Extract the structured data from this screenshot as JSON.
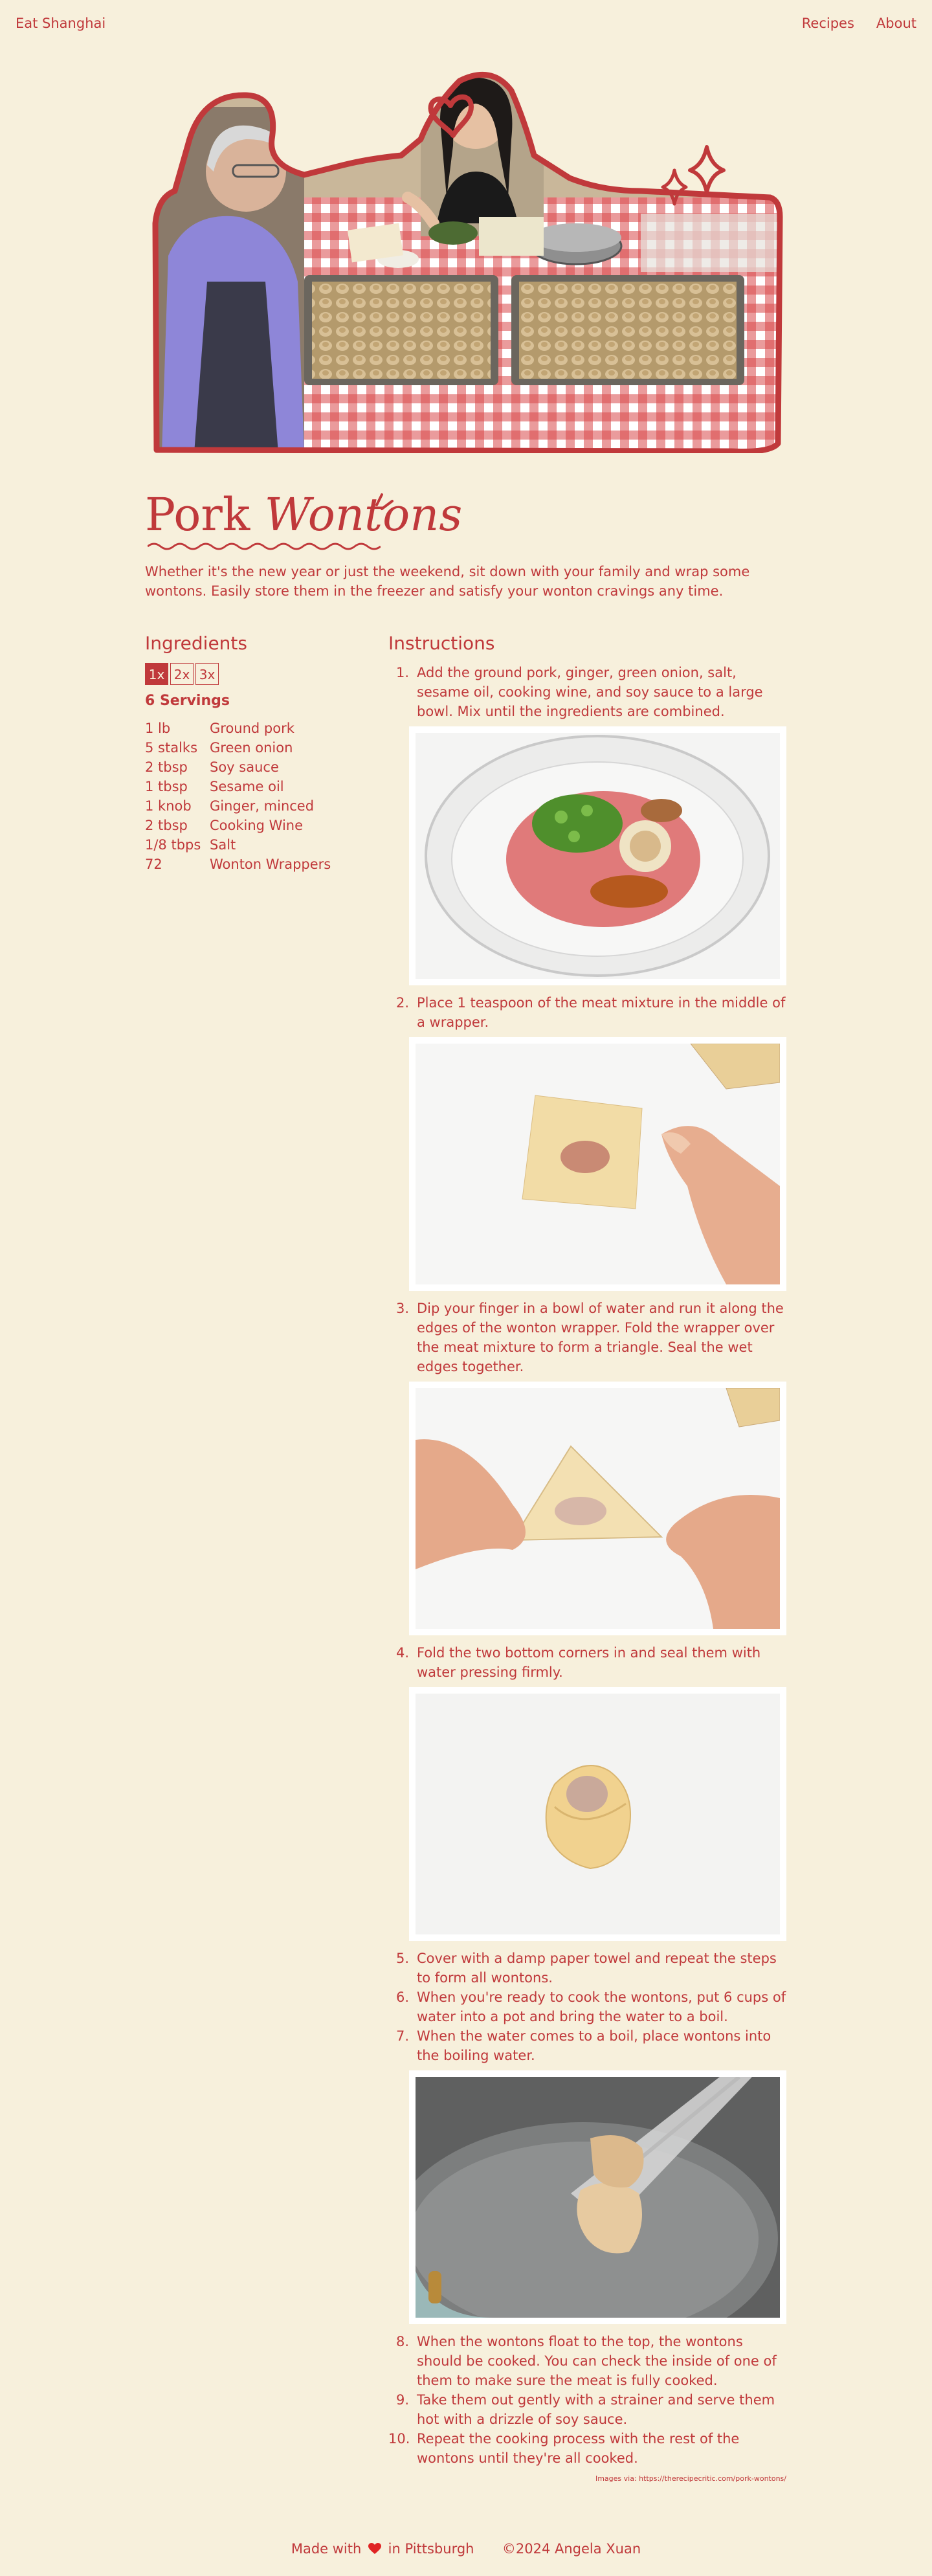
{
  "nav": {
    "brand": "Eat Shanghai",
    "links": [
      "Recipes",
      "About"
    ]
  },
  "recipe": {
    "title_plain": "Pork",
    "title_italic": "Wontons",
    "intro": "Whether it's the new year or just the weekend, sit down with your family and wrap some wontons. Easily store them in the freezer and satisfy your wonton cravings any time."
  },
  "ingredients": {
    "heading": "Ingredients",
    "multipliers": [
      "1x",
      "2x",
      "3x"
    ],
    "active_multiplier": "1x",
    "servings": "6 Servings",
    "items": [
      {
        "qty": "1 lb",
        "name": "Ground pork"
      },
      {
        "qty": "5 stalks",
        "name": "Green onion"
      },
      {
        "qty": "2 tbsp",
        "name": "Soy sauce"
      },
      {
        "qty": "1 tbsp",
        "name": "Sesame oil"
      },
      {
        "qty": "1 knob",
        "name": "Ginger, minced"
      },
      {
        "qty": "2 tbsp",
        "name": "Cooking Wine"
      },
      {
        "qty": "1/8 tbps",
        "name": "Salt"
      },
      {
        "qty": "72",
        "name": "Wonton Wrappers"
      }
    ]
  },
  "instructions": {
    "heading": "Instructions",
    "steps": [
      {
        "num": "1.",
        "text": "Add the ground pork, ginger, green onion, salt, sesame oil, cooking wine, and soy sauce to a large bowl. Mix until the ingredients are combined."
      },
      {
        "num": "2.",
        "text": "Place 1 teaspoon of the meat mixture in the middle of a wrapper."
      },
      {
        "num": "3.",
        "text": "Dip your finger in a bowl of water and run it along the edges of the wonton wrapper. Fold the wrapper over the meat mixture to form a triangle. Seal the wet edges together."
      },
      {
        "num": "4.",
        "text": "Fold the two bottom corners in and seal them with water pressing firmly."
      },
      {
        "num": "5.",
        "text": "Cover with a damp paper towel and repeat the steps to form all wontons."
      },
      {
        "num": "6.",
        "text": "When you're ready to cook the wontons, put 6 cups of water into a pot and bring the water to a boil."
      },
      {
        "num": "7.",
        "text": "When the water comes to a boil, place wontons into the boiling water."
      },
      {
        "num": "8.",
        "text": "When the wontons float to the top, the wontons should be cooked. You can check the inside of one of them to make sure the meat is fully cooked."
      },
      {
        "num": "9.",
        "text": "Take them out gently with a strainer and serve them hot with a drizzle of soy sauce."
      },
      {
        "num": "10.",
        "text": "Repeat the cooking process with the rest of the wontons until they're all cooked."
      }
    ],
    "credit": "Images via: https://therecipecritic.com/pork-wontons/"
  },
  "footer": {
    "made_prefix": "Made with",
    "made_suffix": "in Pittsburgh",
    "copyright": "©2024 Angela Xuan"
  },
  "colors": {
    "background": "#f7f0dc",
    "accent": "#c0393b"
  },
  "icons": {
    "heart": "heart-icon",
    "sparkle": "sparkle-icon"
  }
}
